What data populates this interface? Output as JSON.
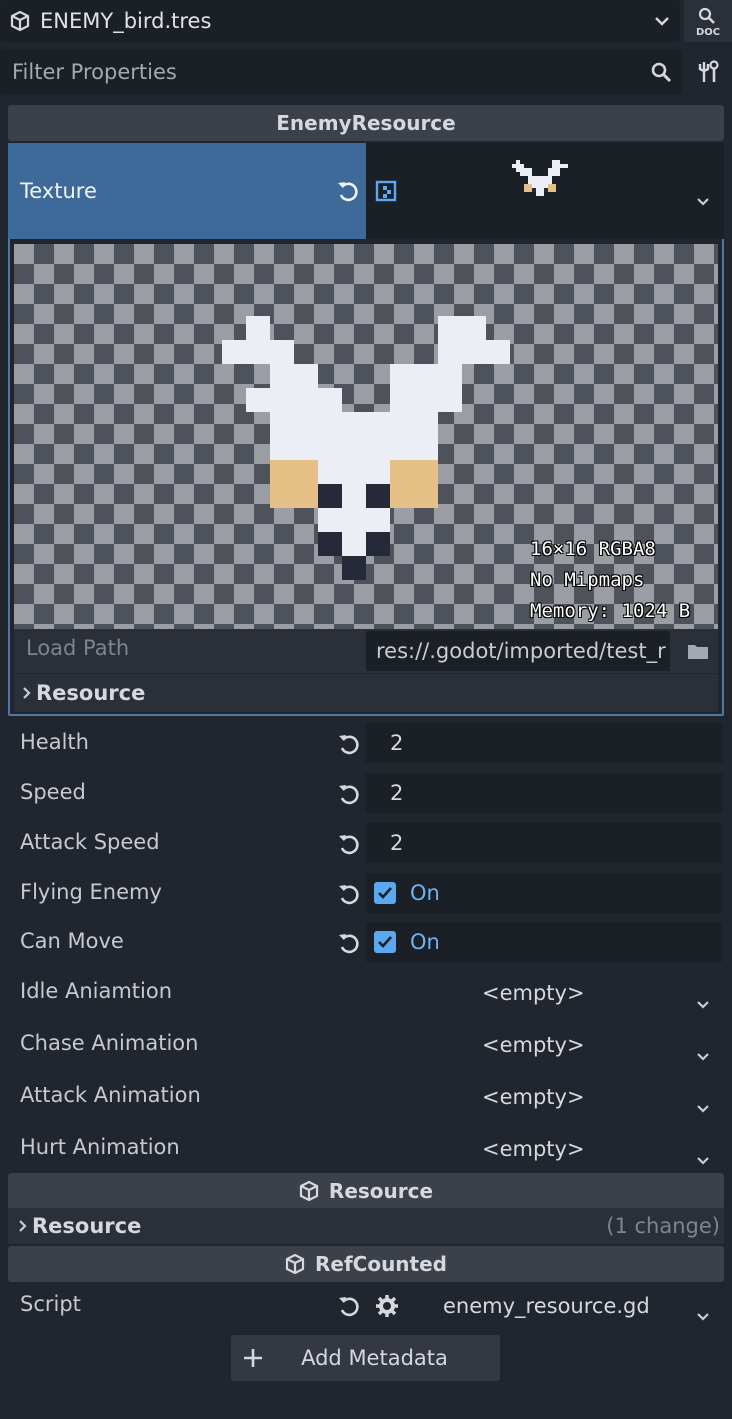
{
  "topbar": {
    "title": "ENEMY_bird.tres",
    "doc_label": "DOC"
  },
  "filter": {
    "placeholder": "Filter Properties"
  },
  "sections": {
    "enemy_resource": "EnemyResource",
    "resource": "Resource",
    "refcounted": "RefCounted"
  },
  "texture": {
    "label": "Texture",
    "info_size": "16×16 RGBA8",
    "info_mipmaps": "No Mipmaps",
    "info_memory": "Memory: 1024 B",
    "load_path_label": "Load Path",
    "load_path_value": "res://.godot/imported/test_r",
    "sub_resource_label": "Resource"
  },
  "properties": {
    "health": {
      "label": "Health",
      "value": "2"
    },
    "speed": {
      "label": "Speed",
      "value": "2"
    },
    "attack_speed": {
      "label": "Attack Speed",
      "value": "2"
    },
    "flying_enemy": {
      "label": "Flying Enemy",
      "value": "On"
    },
    "can_move": {
      "label": "Can Move",
      "value": "On"
    },
    "idle_animation": {
      "label": "Idle Aniamtion",
      "value": "<empty>"
    },
    "chase_animation": {
      "label": "Chase Animation",
      "value": "<empty>"
    },
    "attack_animation": {
      "label": "Attack Animation",
      "value": "<empty>"
    },
    "hurt_animation": {
      "label": "Hurt Animation",
      "value": "<empty>"
    }
  },
  "resource_group": {
    "label": "Resource",
    "change_count": "(1 change)"
  },
  "script": {
    "label": "Script",
    "value": "enemy_resource.gd"
  },
  "add_metadata": {
    "label": "Add Metadata"
  },
  "colors": {
    "accent": "#5aa8f0",
    "selected_row": "#3e6a99",
    "bg": "#21262e"
  },
  "icons": [
    "cube-icon",
    "chevron-down-icon",
    "doc-icon",
    "search-icon",
    "tools-icon",
    "revert-icon",
    "texture-icon",
    "folder-icon",
    "chevron-right-icon",
    "checkbox-icon",
    "gear-icon",
    "plus-icon"
  ]
}
